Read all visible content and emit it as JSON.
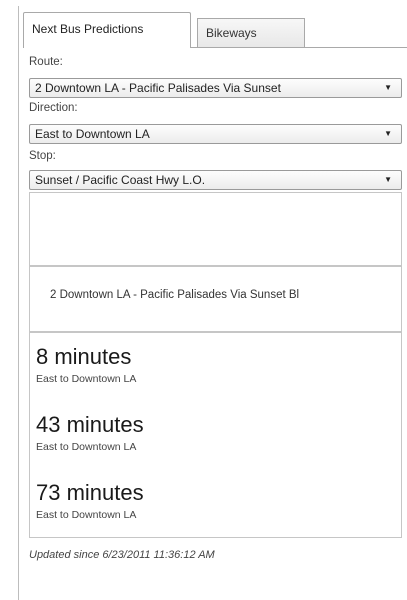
{
  "tabs": [
    {
      "label": "Next Bus Predictions",
      "active": true
    },
    {
      "label": "Bikeways",
      "active": false
    }
  ],
  "route": {
    "label": "Route:",
    "value": "2 Downtown LA - Pacific Palisades Via Sunset"
  },
  "direction": {
    "label": "Direction:",
    "value": "East to Downtown LA"
  },
  "stop": {
    "label": "Stop:",
    "value": "Sunset / Pacific Coast Hwy L.O."
  },
  "route_display": "2 Downtown LA - Pacific Palisades Via Sunset Bl",
  "predictions": [
    {
      "time": "8 minutes",
      "direction": "East to Downtown LA"
    },
    {
      "time": "43 minutes",
      "direction": "East to Downtown LA"
    },
    {
      "time": "73 minutes",
      "direction": "East to Downtown LA"
    }
  ],
  "updated": "Updated since 6/23/2011 11:36:12 AM",
  "icons": {
    "dropdown": "caret-down-icon"
  }
}
